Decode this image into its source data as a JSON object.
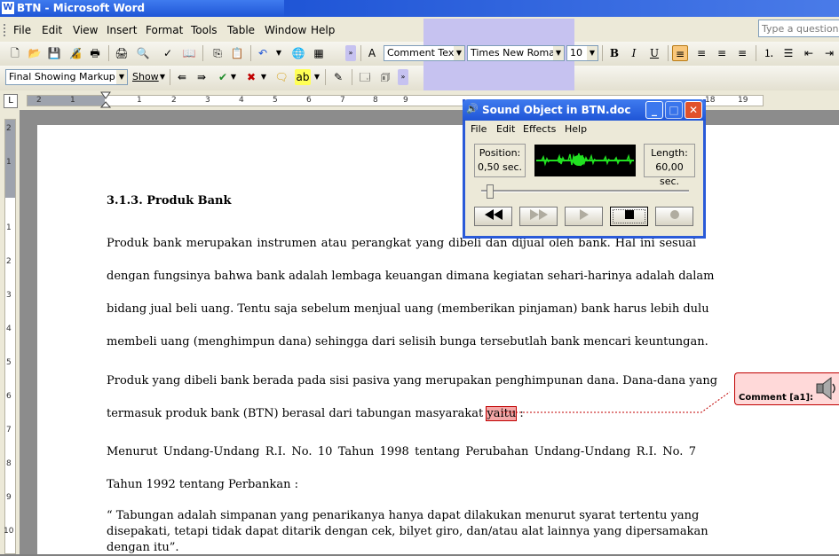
{
  "window": {
    "title": "BTN - Microsoft Word",
    "app_icon": "word-icon"
  },
  "menu": {
    "items": [
      "File",
      "Edit",
      "View",
      "Insert",
      "Format",
      "Tools",
      "Table",
      "Window",
      "Help"
    ],
    "ask_placeholder": "Type a question fo"
  },
  "formatting": {
    "style": "Comment Text",
    "font": "Times New Roman",
    "size": "10"
  },
  "reviewing": {
    "display": "Final Showing Markup",
    "show_label": "Show"
  },
  "ruler": {
    "labels": [
      "2",
      "1",
      "1",
      "2",
      "3",
      "4",
      "5",
      "6",
      "7",
      "8",
      "9",
      "10",
      "18",
      "19"
    ]
  },
  "vruler": {
    "labels": [
      "2",
      "1",
      "1",
      "2",
      "3",
      "4",
      "5",
      "6",
      "7",
      "8",
      "9",
      "10"
    ]
  },
  "doc": {
    "heading": "3.1.3. Produk Bank",
    "p1": [
      "Produk bank merupakan instrumen atau perangkat yang dibeli dan dijual oleh bank. Hal ini sesuai",
      "dengan fungsinya bahwa bank adalah lembaga keuangan dimana kegiatan sehari-harinya adalah dalam",
      "bidang jual beli uang. Tentu saja sebelum menjual uang (memberikan pinjaman) bank harus lebih dulu",
      "membeli uang (menghimpun dana) sehingga dari selisih bunga tersebutlah bank mencari keuntungan."
    ],
    "p2_line1": "Produk yang dibeli bank berada pada sisi pasiva yang merupakan penghimpunan dana. Dana-dana yang",
    "p2_line2_pre": "termasuk produk bank (BTN) berasal dari tabungan masyarakat ",
    "p2_line2_hl": "yaitu",
    "p2_line2_post": " :",
    "p3": [
      "Menurut Undang-Undang R.I. No. 10 Tahun 1998 tentang Perubahan Undang-Undang R.I. No. 7",
      "Tahun 1992 tentang Perbankan :"
    ],
    "quote": [
      "“ Tabungan adalah simpanan yang penarikanya hanya dapat dilakukan menurut syarat tertentu yang",
      "disepakati, tetapi tidak dapat ditarik dengan cek, bilyet giro, dan/atau alat lainnya yang dipersamakan",
      "dengan itu”."
    ]
  },
  "comment": {
    "label": "Comment [a1]:",
    "icon": "speaker-icon"
  },
  "sound": {
    "title": "Sound Object in BTN.doc",
    "menu": [
      "File",
      "Edit",
      "Effects",
      "Help"
    ],
    "position_label": "Position:",
    "position_value": "0,50 sec.",
    "length_label": "Length:",
    "length_value": "60,00 sec.",
    "playback_fraction": 0.008,
    "colors": {
      "wave": "#21e021",
      "title": "#2a5ad8"
    }
  }
}
